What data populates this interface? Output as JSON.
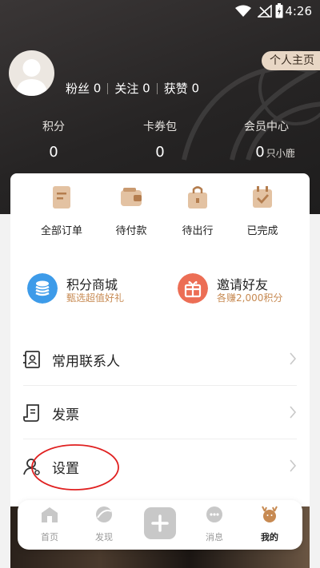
{
  "status": {
    "time": "4:26"
  },
  "profile": {
    "homepage_label": "个人主页",
    "fans_label": "粉丝",
    "fans_value": "0",
    "follow_label": "关注",
    "follow_value": "0",
    "likes_label": "获赞",
    "likes_value": "0"
  },
  "metrics": [
    {
      "label": "积分",
      "value": "0",
      "suffix": ""
    },
    {
      "label": "卡券包",
      "value": "0",
      "suffix": ""
    },
    {
      "label": "会员中心",
      "value": "0",
      "suffix": "只小鹿"
    }
  ],
  "orders": [
    {
      "label": "全部订单",
      "icon": "all-orders-icon"
    },
    {
      "label": "待付款",
      "icon": "wallet-icon"
    },
    {
      "label": "待出行",
      "icon": "bag-icon"
    },
    {
      "label": "已完成",
      "icon": "calendar-check-icon"
    }
  ],
  "promos": [
    {
      "title": "积分商城",
      "subtitle": "甄选超值好礼",
      "icon": "coins-icon",
      "color": "#3d9be9"
    },
    {
      "title": "邀请好友",
      "subtitle": "各赚2,000积分",
      "icon": "gift-icon",
      "color": "#ec6e55"
    }
  ],
  "menu": [
    {
      "label": "常用联系人",
      "icon": "contacts-icon"
    },
    {
      "label": "发票",
      "icon": "invoice-icon"
    },
    {
      "label": "设置",
      "icon": "user-settings-icon"
    }
  ],
  "tabs": [
    {
      "label": "首页",
      "icon": "home-icon"
    },
    {
      "label": "发现",
      "icon": "discover-icon"
    },
    {
      "label": "",
      "icon": "plus-icon"
    },
    {
      "label": "消息",
      "icon": "message-icon"
    },
    {
      "label": "我的",
      "icon": "deer-icon"
    }
  ],
  "colors": {
    "accent": "#c78a52",
    "header_bg": "#2a2828",
    "annotation": "#e02020"
  }
}
